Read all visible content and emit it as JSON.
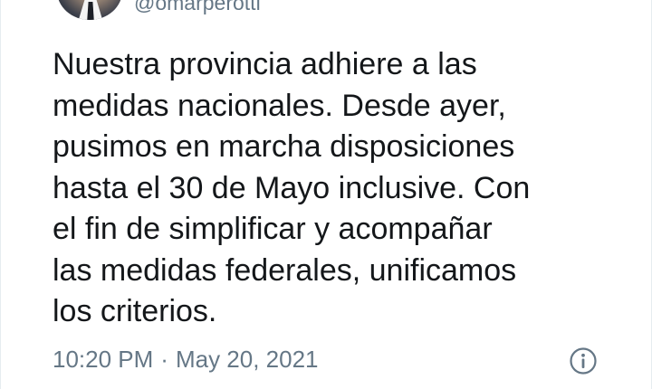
{
  "tweet": {
    "handle": "@omarperotti",
    "text_lines": [
      "Nuestra provincia adhiere a las",
      "medidas nacionales. Desde ayer,",
      "pusimos en marcha disposiciones",
      "hasta el 30 de Mayo inclusive. Con",
      "el fin de simplificar y acompañar",
      "las medidas federales, unificamos",
      "los criterios."
    ],
    "time": "10:20 PM",
    "separator": "·",
    "date": "May 20, 2021"
  },
  "icons": {
    "info": "info-icon",
    "avatar": "profile-avatar"
  },
  "colors": {
    "text": "#14171a",
    "secondary": "#657786",
    "background": "#ffffff"
  }
}
